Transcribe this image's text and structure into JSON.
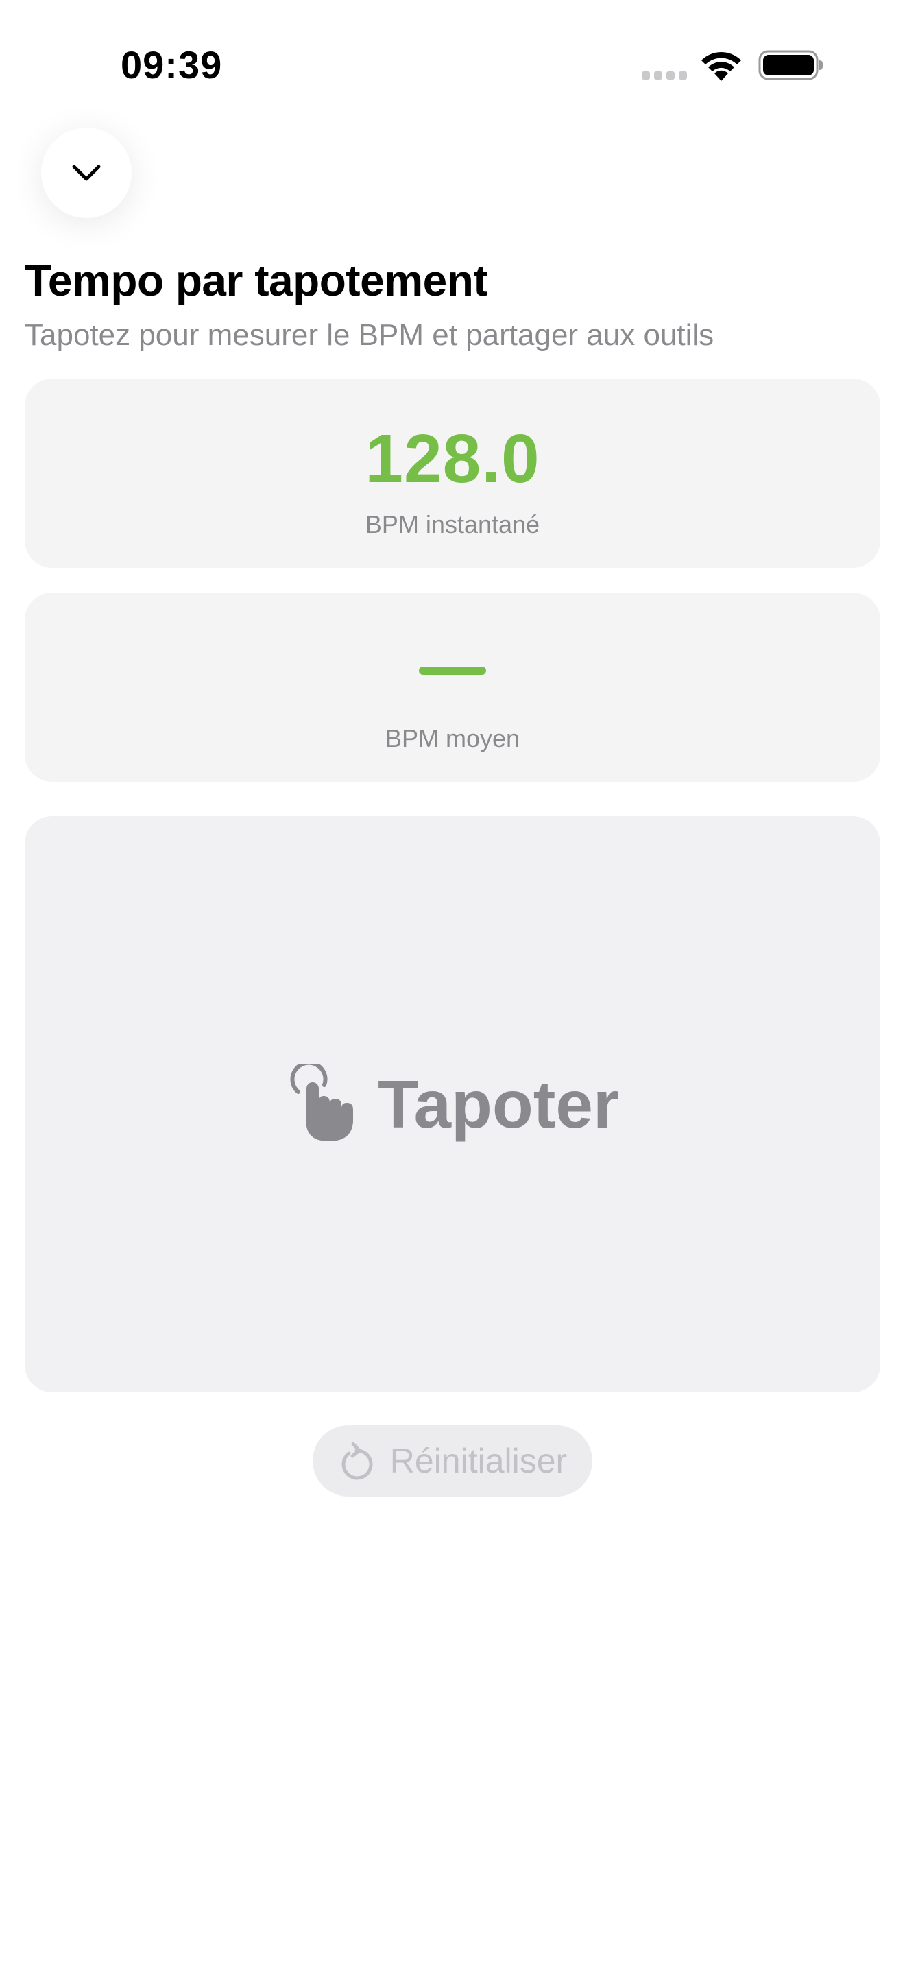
{
  "status_bar": {
    "time": "09:39",
    "icons": [
      "signal-dots-icon",
      "wifi-icon",
      "battery-icon"
    ]
  },
  "header": {
    "collapse_icon": "chevron-down-icon",
    "title": "Tempo par tapotement",
    "subtitle": "Tapotez pour mesurer le BPM et partager aux outils"
  },
  "instant_card": {
    "value": "128.0",
    "label": "BPM instantané"
  },
  "average_card": {
    "value": "",
    "label": "BPM moyen"
  },
  "tap_area": {
    "icon": "hand-tap-icon",
    "label": "Tapoter"
  },
  "reset": {
    "icon": "reset-icon",
    "label": "Réinitialiser"
  },
  "colors": {
    "accent": "#76be48",
    "card_background": "#f4f4f5",
    "tap_background": "#f1f1f4",
    "secondary_text": "#8a8a8e",
    "disabled_text": "#c2c2c6"
  }
}
